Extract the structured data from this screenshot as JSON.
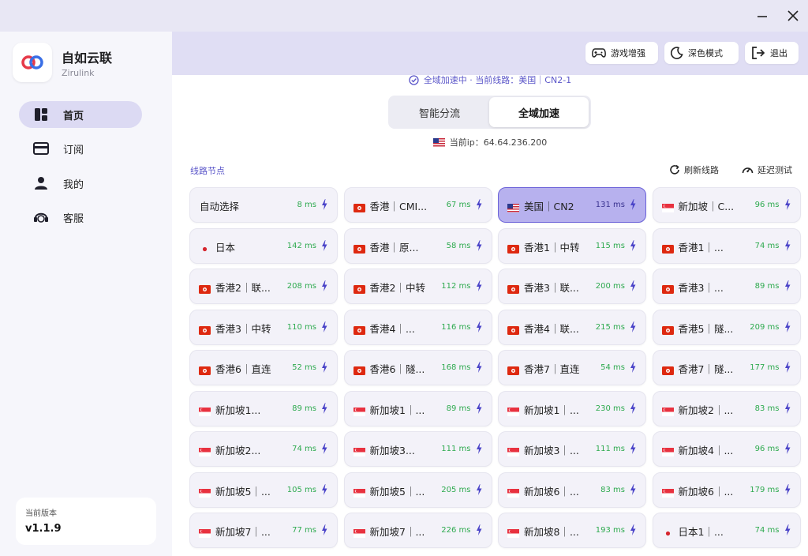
{
  "window": {
    "minimize_icon": "minimize-icon",
    "close_icon": "close-icon"
  },
  "brand": {
    "name": "自如云联",
    "subtitle": "Zirulink",
    "logo_colors": [
      "#e63a4a",
      "#3a6fe6"
    ]
  },
  "sidebar": {
    "items": [
      {
        "label": "首页",
        "icon": "dashboard-icon",
        "active": true
      },
      {
        "label": "订阅",
        "icon": "card-icon",
        "active": false
      },
      {
        "label": "我的",
        "icon": "user-icon",
        "active": false
      },
      {
        "label": "客服",
        "icon": "support-icon",
        "active": false
      }
    ],
    "version_label": "当前版本",
    "version_value": "v1.1.9"
  },
  "topbar": {
    "game_boost": "游戏增强",
    "dark_mode": "深色模式",
    "logout": "退出"
  },
  "main": {
    "status_text": "全域加速中 · 当前线路：美国｜CN2-1",
    "modes": {
      "smart": "智能分流",
      "global": "全域加速",
      "selected": "global"
    },
    "current_ip": "当前ip：64.64.236.200",
    "section_title": "线路节点",
    "refresh_label": "刷新线路",
    "latency_test_label": "延迟测试"
  },
  "colors": {
    "accent": "#5b56c9",
    "latency_green": "#2eaa4f",
    "selected_card": "#b7b1ee"
  },
  "nodes": [
    {
      "name": "自动选择",
      "latency": "8 ms",
      "flag": "none"
    },
    {
      "name": "香港｜CMI...",
      "latency": "67 ms",
      "flag": "hk"
    },
    {
      "name": "美国｜CN2",
      "latency": "131 ms",
      "flag": "us",
      "selected": true
    },
    {
      "name": "新加坡｜C...",
      "latency": "96 ms",
      "flag": "sg"
    },
    {
      "name": "日本",
      "latency": "142 ms",
      "flag": "jp"
    },
    {
      "name": "香港｜原...",
      "latency": "58 ms",
      "flag": "hk"
    },
    {
      "name": "香港1｜中转",
      "latency": "115 ms",
      "flag": "hk"
    },
    {
      "name": "香港1｜...",
      "latency": "74 ms",
      "flag": "hk"
    },
    {
      "name": "香港2｜联...",
      "latency": "208 ms",
      "flag": "hk"
    },
    {
      "name": "香港2｜中转",
      "latency": "112 ms",
      "flag": "hk"
    },
    {
      "name": "香港3｜联...",
      "latency": "200 ms",
      "flag": "hk"
    },
    {
      "name": "香港3｜...",
      "latency": "89 ms",
      "flag": "hk"
    },
    {
      "name": "香港3｜中转",
      "latency": "110 ms",
      "flag": "hk"
    },
    {
      "name": "香港4｜...",
      "latency": "116 ms",
      "flag": "hk"
    },
    {
      "name": "香港4｜联...",
      "latency": "215 ms",
      "flag": "hk"
    },
    {
      "name": "香港5｜隧...",
      "latency": "209 ms",
      "flag": "hk"
    },
    {
      "name": "香港6｜直连",
      "latency": "52 ms",
      "flag": "hk"
    },
    {
      "name": "香港6｜隧...",
      "latency": "168 ms",
      "flag": "hk"
    },
    {
      "name": "香港7｜直连",
      "latency": "54 ms",
      "flag": "hk"
    },
    {
      "name": "香港7｜隧...",
      "latency": "177 ms",
      "flag": "hk"
    },
    {
      "name": "新加坡1...",
      "latency": "89 ms",
      "flag": "sg"
    },
    {
      "name": "新加坡1｜...",
      "latency": "89 ms",
      "flag": "sg"
    },
    {
      "name": "新加坡1｜...",
      "latency": "230 ms",
      "flag": "sg"
    },
    {
      "name": "新加坡2｜...",
      "latency": "83 ms",
      "flag": "sg"
    },
    {
      "name": "新加坡2...",
      "latency": "74 ms",
      "flag": "sg"
    },
    {
      "name": "新加坡3...",
      "latency": "111 ms",
      "flag": "sg"
    },
    {
      "name": "新加坡3｜...",
      "latency": "111 ms",
      "flag": "sg"
    },
    {
      "name": "新加坡4｜...",
      "latency": "96 ms",
      "flag": "sg"
    },
    {
      "name": "新加坡5｜...",
      "latency": "105 ms",
      "flag": "sg"
    },
    {
      "name": "新加坡5｜...",
      "latency": "205 ms",
      "flag": "sg"
    },
    {
      "name": "新加坡6｜...",
      "latency": "83 ms",
      "flag": "sg"
    },
    {
      "name": "新加坡6｜...",
      "latency": "179 ms",
      "flag": "sg"
    },
    {
      "name": "新加坡7｜...",
      "latency": "77 ms",
      "flag": "sg"
    },
    {
      "name": "新加坡7｜...",
      "latency": "226 ms",
      "flag": "sg"
    },
    {
      "name": "新加坡8｜...",
      "latency": "193 ms",
      "flag": "sg"
    },
    {
      "name": "日本1｜...",
      "latency": "74 ms",
      "flag": "jp"
    }
  ]
}
